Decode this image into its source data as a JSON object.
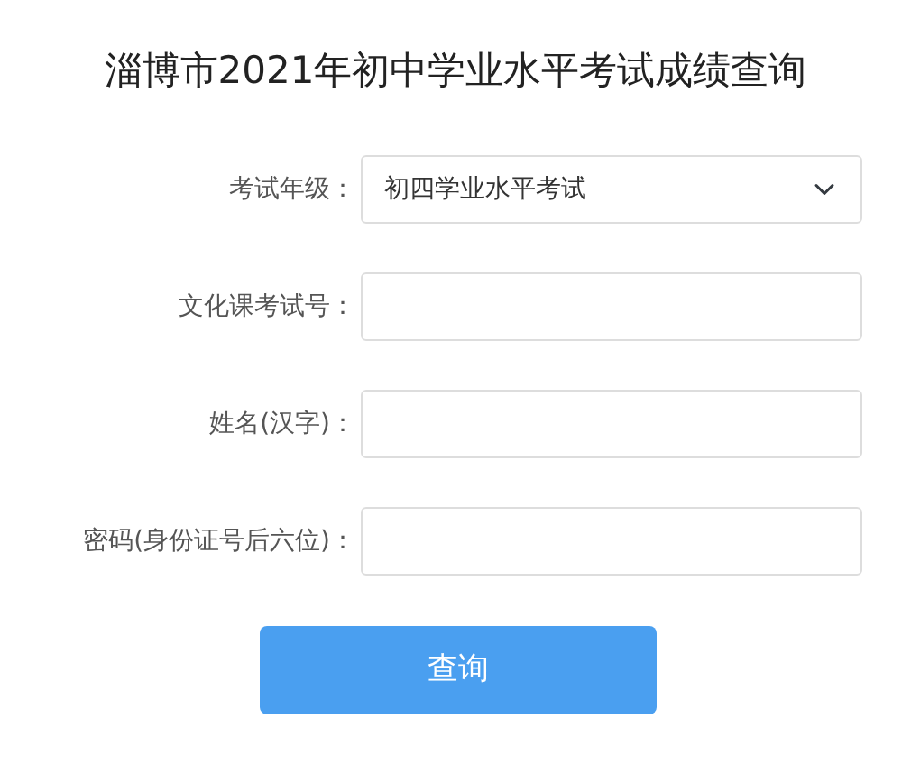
{
  "title": "淄博市2021年初中学业水平考试成绩查询",
  "fields": [
    {
      "kind": "select",
      "label": "考试年级：",
      "value": "初四学业水平考试"
    },
    {
      "kind": "text",
      "label": "文化课考试号："
    },
    {
      "kind": "text",
      "label": "姓名(汉字)："
    },
    {
      "kind": "text",
      "label": "密码(身份证号后六位)："
    }
  ],
  "submit": "查询"
}
